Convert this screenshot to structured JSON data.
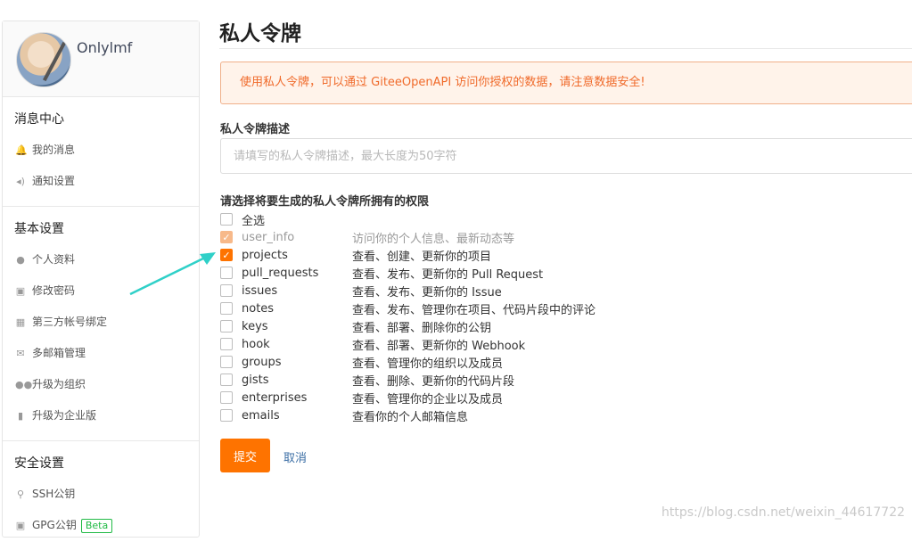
{
  "profile": {
    "username": "Onlylmf"
  },
  "sidebar": {
    "sections": [
      {
        "title": "消息中心",
        "items": [
          {
            "label": "我的消息",
            "icon": "bell-icon"
          },
          {
            "label": "通知设置",
            "icon": "volume-icon"
          }
        ]
      },
      {
        "title": "基本设置",
        "items": [
          {
            "label": "个人资料",
            "icon": "user-icon"
          },
          {
            "label": "修改密码",
            "icon": "lock-icon"
          },
          {
            "label": "第三方帐号绑定",
            "icon": "contact-card-icon"
          },
          {
            "label": "多邮箱管理",
            "icon": "mail-icon"
          },
          {
            "label": "升级为组织",
            "icon": "users-icon"
          },
          {
            "label": "升级为企业版",
            "icon": "building-icon"
          }
        ]
      },
      {
        "title": "安全设置",
        "items": [
          {
            "label": "SSH公钥",
            "icon": "key-icon"
          },
          {
            "label": "GPG公钥",
            "icon": "lock-icon",
            "badge": "Beta"
          }
        ]
      }
    ]
  },
  "main": {
    "title": "私人令牌",
    "warning": "使用私人令牌，可以通过 GiteeOpenAPI 访问你授权的数据，请注意数据安全!",
    "desc_label": "私人令牌描述",
    "desc_placeholder": "请填写的私人令牌描述，最大长度为50字符",
    "perms_label": "请选择将要生成的私人令牌所拥有的权限",
    "select_all": "全选",
    "permissions": [
      {
        "name": "user_info",
        "desc": "访问你的个人信息、最新动态等",
        "checked": true,
        "disabled": true
      },
      {
        "name": "projects",
        "desc": "查看、创建、更新你的项目",
        "checked": true,
        "disabled": false
      },
      {
        "name": "pull_requests",
        "desc": "查看、发布、更新你的 Pull Request",
        "checked": false
      },
      {
        "name": "issues",
        "desc": "查看、发布、更新你的 Issue",
        "checked": false
      },
      {
        "name": "notes",
        "desc": "查看、发布、管理你在项目、代码片段中的评论",
        "checked": false
      },
      {
        "name": "keys",
        "desc": "查看、部署、删除你的公钥",
        "checked": false
      },
      {
        "name": "hook",
        "desc": "查看、部署、更新你的 Webhook",
        "checked": false
      },
      {
        "name": "groups",
        "desc": "查看、管理你的组织以及成员",
        "checked": false
      },
      {
        "name": "gists",
        "desc": "查看、删除、更新你的代码片段",
        "checked": false
      },
      {
        "name": "enterprises",
        "desc": "查看、管理你的企业以及成员",
        "checked": false
      },
      {
        "name": "emails",
        "desc": "查看你的个人邮箱信息",
        "checked": false
      }
    ],
    "submit_label": "提交",
    "cancel_label": "取消"
  },
  "colors": {
    "accent": "#fe7300",
    "warning_bg": "#fff3ea",
    "warning_text": "#f06a2a",
    "link": "#3b6ea5",
    "arrow": "#2fd0c8"
  },
  "watermark": "https://blog.csdn.net/weixin_44617722"
}
